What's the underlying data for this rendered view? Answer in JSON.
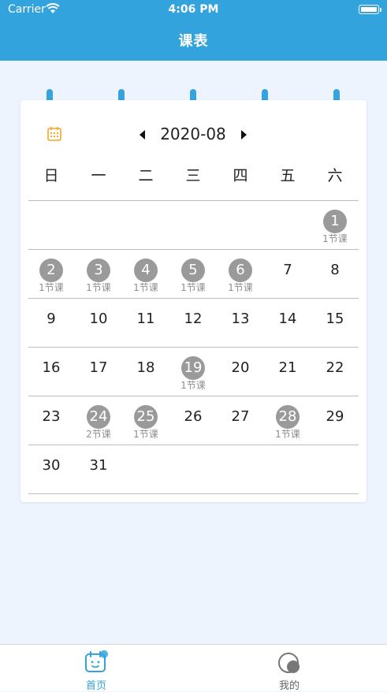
{
  "status_bar": {
    "carrier": "Carrier",
    "time": "4:06 PM"
  },
  "header": {
    "title": "课表"
  },
  "calendar": {
    "month_label": "2020-08",
    "weekdays": [
      "日",
      "一",
      "二",
      "三",
      "四",
      "五",
      "六"
    ],
    "days": [
      {
        "day": "1",
        "count": "1节课"
      },
      {
        "day": "2",
        "count": "1节课"
      },
      {
        "day": "3",
        "count": "1节课"
      },
      {
        "day": "4",
        "count": "1节课"
      },
      {
        "day": "5",
        "count": "1节课"
      },
      {
        "day": "6",
        "count": "1节课"
      },
      {
        "day": "7",
        "count": ""
      },
      {
        "day": "8",
        "count": ""
      },
      {
        "day": "9",
        "count": ""
      },
      {
        "day": "10",
        "count": ""
      },
      {
        "day": "11",
        "count": ""
      },
      {
        "day": "12",
        "count": ""
      },
      {
        "day": "13",
        "count": ""
      },
      {
        "day": "14",
        "count": ""
      },
      {
        "day": "15",
        "count": ""
      },
      {
        "day": "16",
        "count": ""
      },
      {
        "day": "17",
        "count": ""
      },
      {
        "day": "18",
        "count": ""
      },
      {
        "day": "19",
        "count": "1节课"
      },
      {
        "day": "20",
        "count": ""
      },
      {
        "day": "21",
        "count": ""
      },
      {
        "day": "22",
        "count": ""
      },
      {
        "day": "23",
        "count": ""
      },
      {
        "day": "24",
        "count": "2节课"
      },
      {
        "day": "25",
        "count": "1节课"
      },
      {
        "day": "26",
        "count": ""
      },
      {
        "day": "27",
        "count": ""
      },
      {
        "day": "28",
        "count": "1节课"
      },
      {
        "day": "29",
        "count": ""
      },
      {
        "day": "30",
        "count": ""
      },
      {
        "day": "31",
        "count": ""
      }
    ]
  },
  "tabbar": {
    "home_label": "首页",
    "mine_label": "我的",
    "active_color": "#33a3dd"
  },
  "colors": {
    "header": "#33a3dd",
    "marked_day": "#9a9a9a",
    "background": "#eef4fe"
  }
}
